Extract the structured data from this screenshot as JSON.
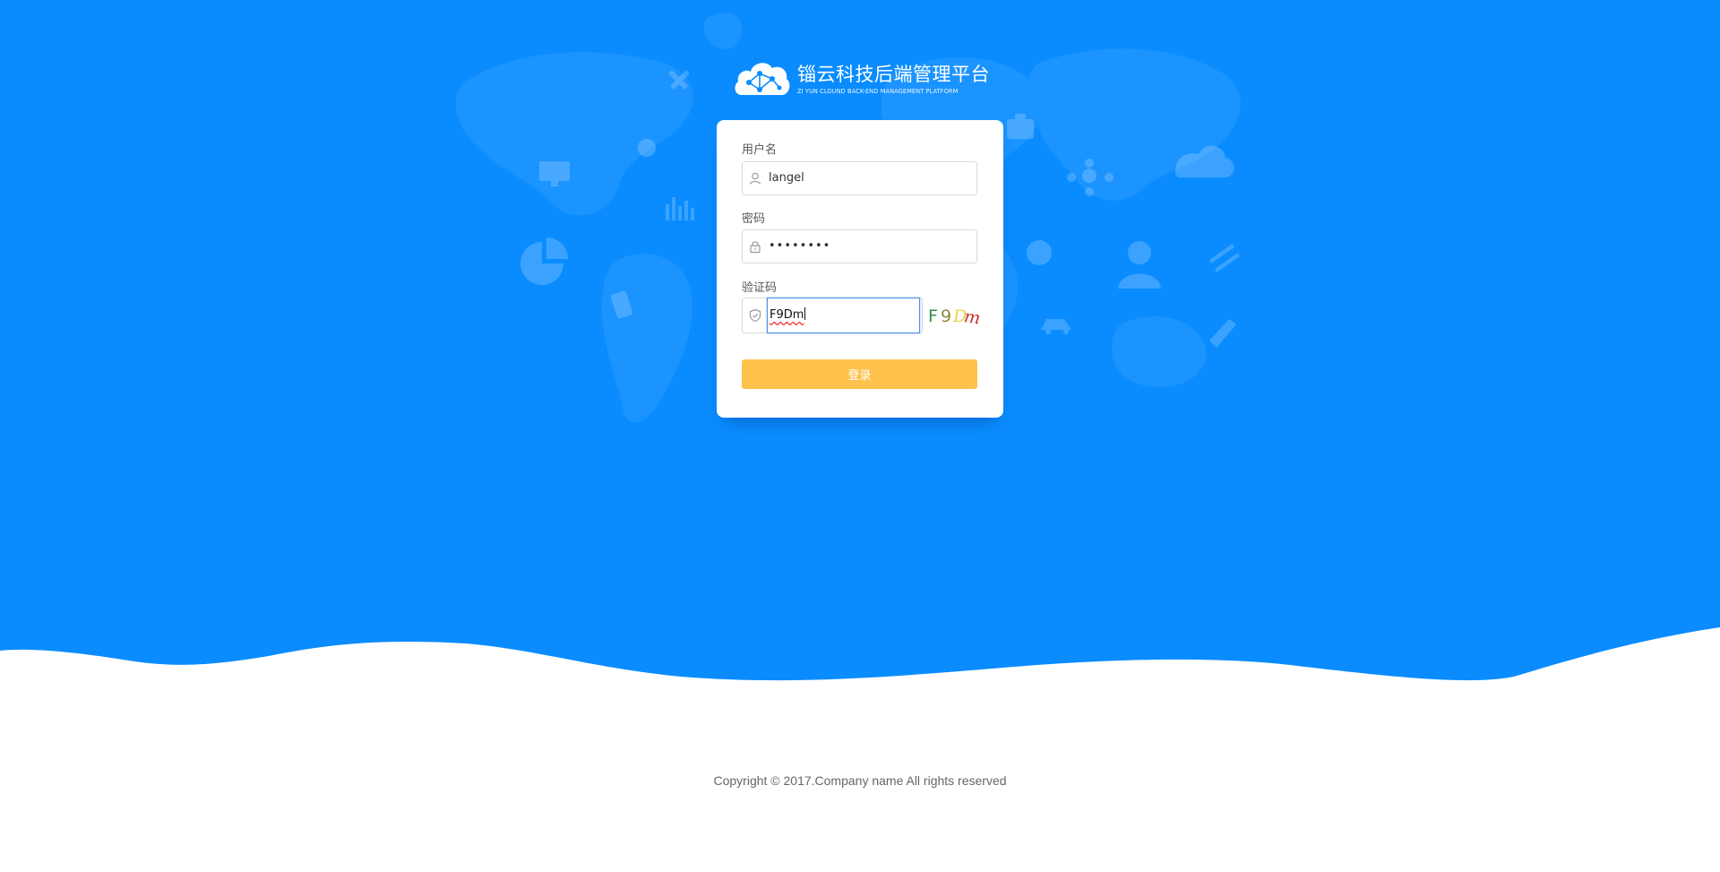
{
  "brand": {
    "title": "锱云科技后端管理平台",
    "subtitle": "ZI YUN CLOUND BACK-END MANAGEMENT PLATFORM"
  },
  "form": {
    "username": {
      "label": "用户名",
      "value": "langel",
      "icon": "user-icon"
    },
    "password": {
      "label": "密码",
      "value": "••••••••",
      "icon": "lock-icon"
    },
    "captcha": {
      "label": "验证码",
      "value": "F9Dm",
      "icon": "shield-icon",
      "image_chars": [
        "F",
        "9",
        "D",
        "m"
      ],
      "image_colors": [
        "#2f8f4e",
        "#8a8a3a",
        "#e8d24a",
        "#c62e2e"
      ]
    },
    "submit_label": "登录"
  },
  "footer": {
    "copyright": "Copyright © 2017.Company name All rights reserved"
  },
  "colors": {
    "background_blue": "#0a8cff",
    "button_yellow": "#ffc34d",
    "focus_blue": "#4a90e2"
  }
}
